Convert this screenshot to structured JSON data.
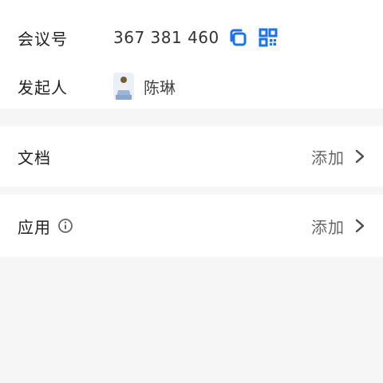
{
  "meeting": {
    "id_label": "会议号",
    "id_value": "367 381 460",
    "host_label": "发起人",
    "host_name": "陈琳"
  },
  "documents": {
    "label": "文档",
    "action": "添加"
  },
  "apps": {
    "label": "应用",
    "action": "添加"
  },
  "colors": {
    "accent": "#1a73e8",
    "background": "#f6f6f7",
    "card": "#ffffff"
  },
  "icons": [
    "copy-icon",
    "qr-code-icon",
    "info-icon",
    "chevron-right-icon"
  ]
}
